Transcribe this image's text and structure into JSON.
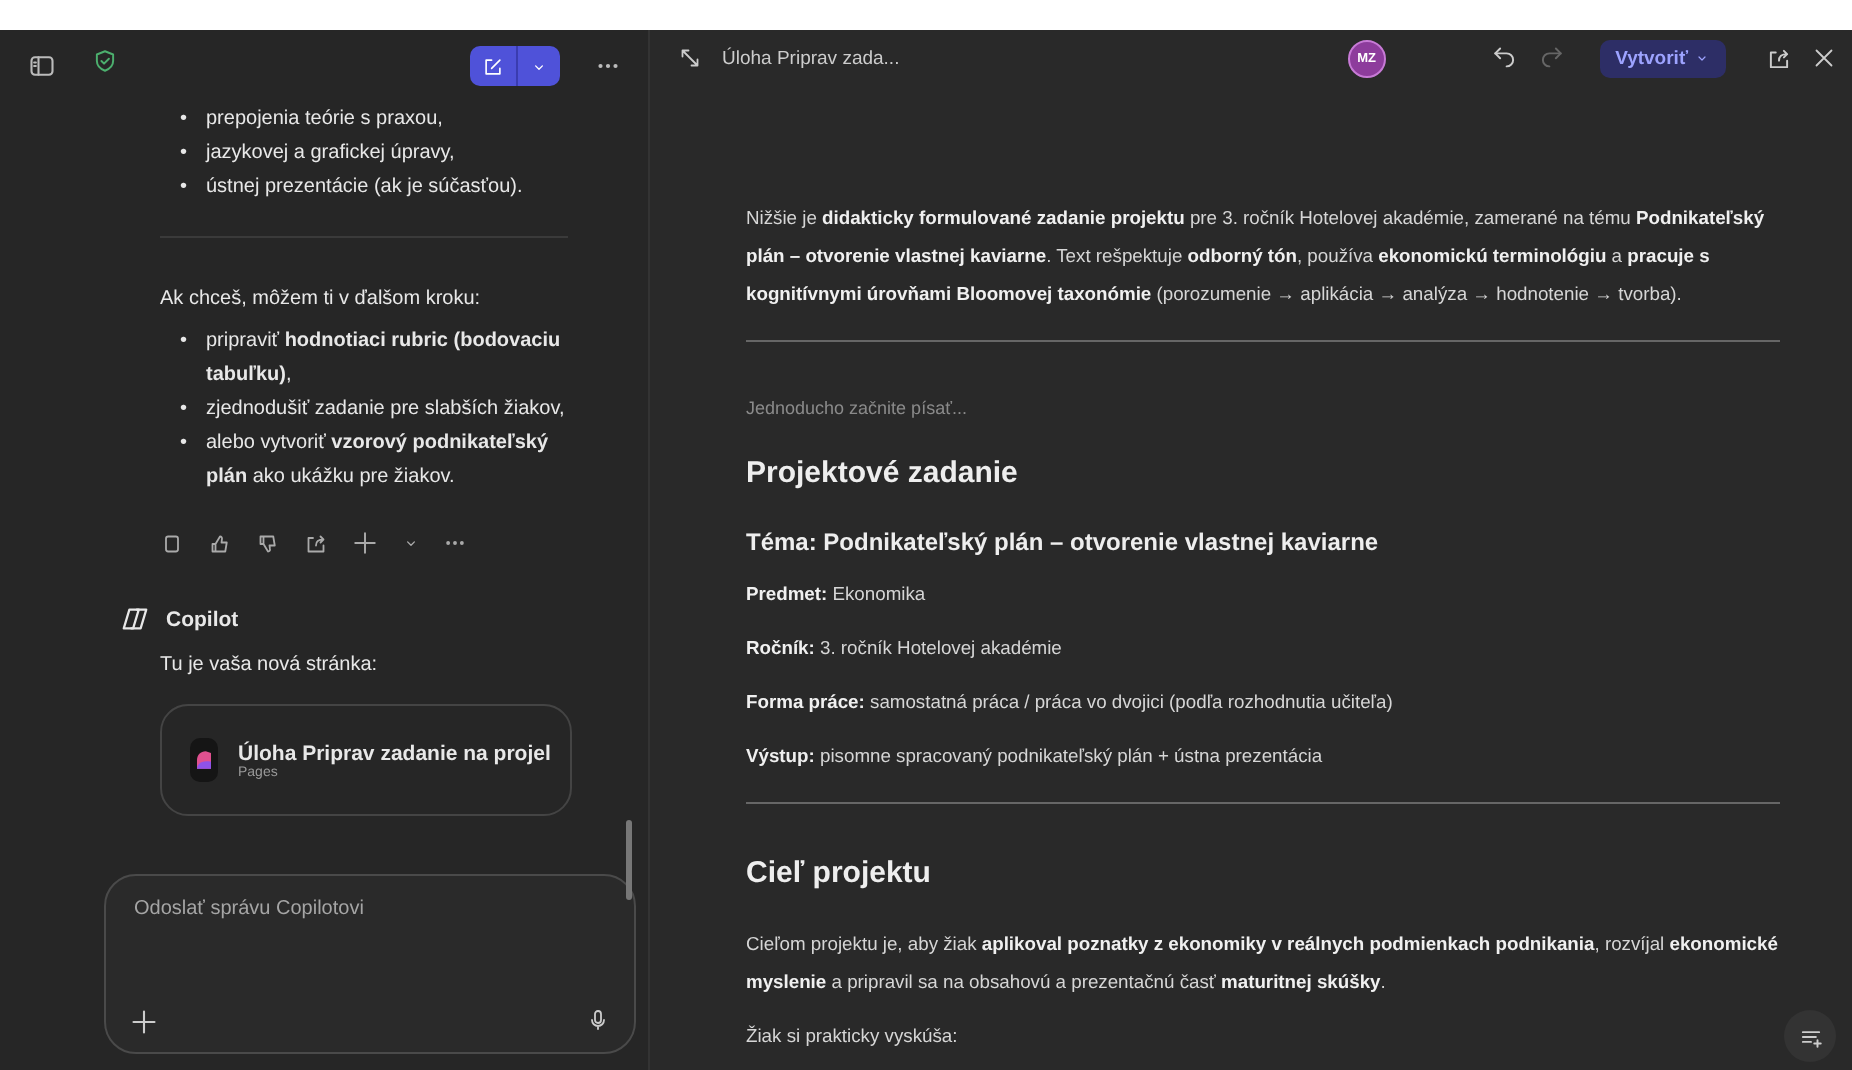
{
  "chat": {
    "list_1": [
      {
        "bullet": "•",
        "text": "prepojenia teórie s praxou,"
      },
      {
        "bullet": "•",
        "text": "jazykovej a grafickej úpravy,"
      },
      {
        "bullet": "•",
        "text": "ústnej prezentácie (ak je súčasťou)."
      }
    ],
    "offer": "Ak chceš, môžem ti v ďalšom kroku:",
    "list_2": [
      {
        "bullet": "•",
        "text": "pripraviť **hodnotiaci rubric (bodovaciu tabuľku)**,"
      },
      {
        "bullet": "•",
        "text": "zjednodušiť zadanie pre slabších žiakov,"
      },
      {
        "bullet": "•",
        "text": "alebo vytvoriť **vzorový podnikateľský plán** ako ukážku pre žiakov."
      }
    ],
    "copilot_name": "Copilot",
    "copilot_message": "Tu je vaša nová stránka:",
    "page_card": {
      "title": "Úloha Priprav zadanie na projel",
      "subtitle": "Pages"
    },
    "composer": {
      "placeholder": "Odoslať správu Copilotovi"
    }
  },
  "document": {
    "title": "Úloha Priprav zada...",
    "avatar": "MZ",
    "undo_disabled": false,
    "redo_disabled": true,
    "create_button": "Vytvoriť",
    "blocks": [
      {
        "kind": "paragraph",
        "text": "Nižšie je **didakticky formulované zadanie projektu** pre 3. ročník Hotelovej akadémie, zamerané na tému **Podnikateľský plán – otvorenie vlastnej kaviarne**. Text rešpektuje **odborný tón**, používa **ekonomickú terminológiu** a **pracuje s kognitívnymi úrovňami Bloomovej taxonómie** (porozumenie → aplikácia → analýza → hodnotenie → tvorba)."
      },
      {
        "kind": "rule"
      },
      {
        "kind": "hint",
        "text": "Jednoducho začnite písať..."
      },
      {
        "kind": "heading",
        "text": "Projektové zadanie"
      },
      {
        "kind": "subheading",
        "text": "Téma: Podnikateľský plán – otvorenie vlastnej kaviarne"
      },
      {
        "kind": "paragraph",
        "text": "**Predmet:** Ekonomika"
      },
      {
        "kind": "paragraph",
        "text": "**Ročník:** 3. ročník Hotelovej akadémie"
      },
      {
        "kind": "paragraph",
        "text": "**Forma práce:** samostatná práca / práca vo dvojici (podľa rozhodnutia učiteľa)"
      },
      {
        "kind": "paragraph",
        "text": "**Výstup:** pisomne spracovaný podnikateľský plán + ústna prezentácia"
      },
      {
        "kind": "rule"
      },
      {
        "kind": "heading",
        "text": "Cieľ projektu"
      },
      {
        "kind": "paragraph",
        "text": "Cieľom projektu je, aby žiak **aplikoval poznatky z ekonomiky v reálnych podmienkach podnikania**, rozvíjal **ekonomické myslenie** a pripravil sa na obsahovú a prezentačnú časť **maturitnej skúšky**."
      },
      {
        "kind": "paragraph",
        "text": "Žiak si prakticky vyskúša:"
      }
    ]
  }
}
